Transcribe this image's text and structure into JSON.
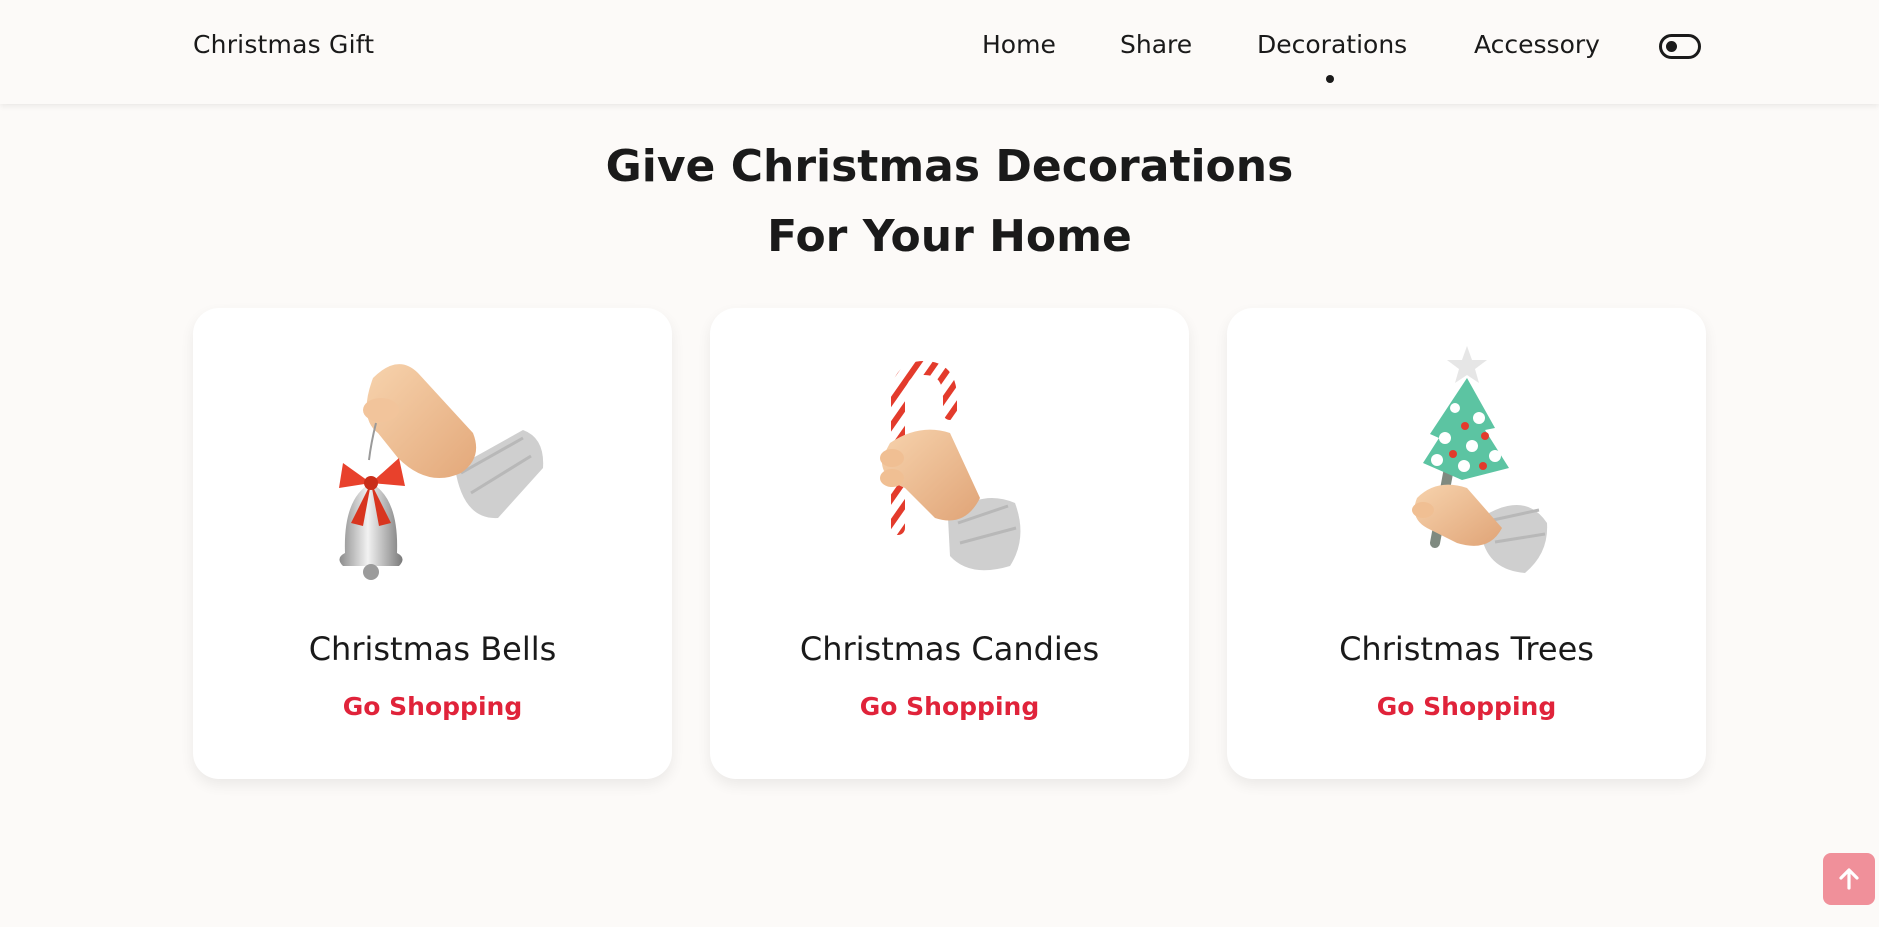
{
  "header": {
    "logo": "Christmas Gift",
    "nav": [
      {
        "label": "Home",
        "active": false
      },
      {
        "label": "Share",
        "active": false
      },
      {
        "label": "Decorations",
        "active": true
      },
      {
        "label": "Accessory",
        "active": false
      }
    ],
    "theme_toggle_icon": "toggle-icon"
  },
  "section": {
    "title_line1": "Give Christmas Decorations",
    "title_line2": "For Your Home"
  },
  "cards": [
    {
      "title": "Christmas Bells",
      "link": "Go Shopping",
      "icon": "hand-holding-bell"
    },
    {
      "title": "Christmas Candies",
      "link": "Go Shopping",
      "icon": "hand-holding-candy-cane"
    },
    {
      "title": "Christmas Trees",
      "link": "Go Shopping",
      "icon": "hand-holding-christmas-tree"
    }
  ],
  "scroll_up_icon": "arrow-up-icon",
  "colors": {
    "accent": "#e0233a",
    "background": "#fcfaf8",
    "scroll_button": "#f0909a"
  }
}
